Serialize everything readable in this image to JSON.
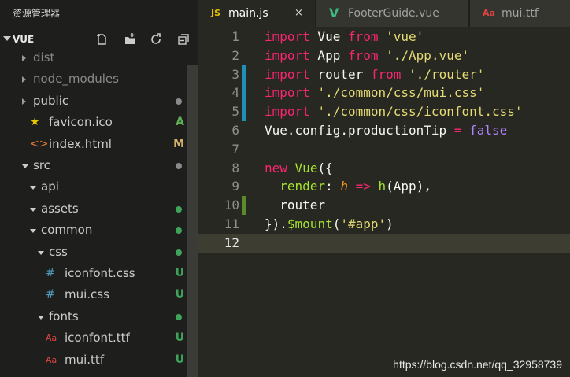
{
  "sidebar": {
    "header_title": "资源管理器",
    "section_title": "VUE",
    "actions": [
      "new-file-icon",
      "new-folder-icon",
      "refresh-icon",
      "collapse-all-icon"
    ],
    "items": [
      {
        "label": "dist",
        "type": "folder",
        "expanded": false,
        "dim": true
      },
      {
        "label": "node_modules",
        "type": "folder",
        "expanded": false,
        "dim": true
      },
      {
        "label": "public",
        "type": "folder",
        "expanded": false,
        "status": "dot",
        "status_color": "#8a8a8a"
      },
      {
        "label": "favicon.ico",
        "type": "file",
        "icon": "star-icon",
        "icon_color": "#e5c400",
        "badge": "A",
        "badge_color": "#5fae55"
      },
      {
        "label": "index.html",
        "type": "file",
        "icon": "html-icon",
        "icon_color": "#e37933",
        "badge": "M",
        "badge_color": "#d4b06a"
      },
      {
        "label": "src",
        "type": "folder",
        "expanded": true,
        "status": "dot",
        "status_color": "#8a8a8a"
      },
      {
        "label": "api",
        "type": "folder",
        "expanded": true
      },
      {
        "label": "assets",
        "type": "folder",
        "expanded": true,
        "status": "dot",
        "status_color": "#3fa35c"
      },
      {
        "label": "common",
        "type": "folder",
        "expanded": true,
        "status": "dot",
        "status_color": "#3fa35c"
      },
      {
        "label": "css",
        "type": "folder",
        "expanded": true,
        "status": "dot",
        "status_color": "#3fa35c"
      },
      {
        "label": "iconfont.css",
        "type": "file",
        "icon": "hash-icon",
        "icon_color": "#519aba",
        "badge": "U",
        "badge_color": "#3fa35c"
      },
      {
        "label": "mui.css",
        "type": "file",
        "icon": "hash-icon",
        "icon_color": "#519aba",
        "badge": "U",
        "badge_color": "#3fa35c"
      },
      {
        "label": "fonts",
        "type": "folder",
        "expanded": true,
        "status": "dot",
        "status_color": "#3fa35c"
      },
      {
        "label": "iconfont.ttf",
        "type": "file",
        "icon": "font-icon",
        "icon_color": "#e04444",
        "badge": "U",
        "badge_color": "#3fa35c"
      },
      {
        "label": "mui.ttf",
        "type": "file",
        "icon": "font-icon",
        "icon_color": "#e04444",
        "badge": "U",
        "badge_color": "#3fa35c"
      }
    ]
  },
  "tabs": [
    {
      "label": "main.js",
      "icon_text": "JS",
      "icon_color": "#e5c400",
      "active": true,
      "close": "×"
    },
    {
      "label": "FooterGuide.vue",
      "icon_text": "V",
      "icon_color": "#41b883",
      "active": false
    },
    {
      "label": "mui.ttf",
      "icon_text": "Aa",
      "icon_color": "#e04444",
      "active": false
    }
  ],
  "editor": {
    "current_line": 12,
    "lines": [
      {
        "n": "1",
        "tokens": [
          [
            "kw",
            "import"
          ],
          [
            "",
            " Vue "
          ],
          [
            "kw",
            "from"
          ],
          [
            "",
            " "
          ],
          [
            "str",
            "'vue'"
          ]
        ]
      },
      {
        "n": "2",
        "tokens": [
          [
            "kw",
            "import"
          ],
          [
            "",
            " App "
          ],
          [
            "kw",
            "from"
          ],
          [
            "",
            " "
          ],
          [
            "str",
            "'./App.vue'"
          ]
        ]
      },
      {
        "n": "3",
        "tokens": [
          [
            "kw",
            "import"
          ],
          [
            "",
            " router "
          ],
          [
            "kw",
            "from"
          ],
          [
            "",
            " "
          ],
          [
            "str",
            "'./router'"
          ]
        ]
      },
      {
        "n": "4",
        "tokens": [
          [
            "kw",
            "import"
          ],
          [
            "",
            " "
          ],
          [
            "str",
            "'./common/css/mui.css'"
          ]
        ]
      },
      {
        "n": "5",
        "tokens": [
          [
            "kw",
            "import"
          ],
          [
            "",
            " "
          ],
          [
            "str",
            "'./common/css/iconfont.css'"
          ]
        ]
      },
      {
        "n": "6",
        "tokens": [
          [
            "",
            "Vue.config.productionTip "
          ],
          [
            "kw",
            "="
          ],
          [
            "",
            " "
          ],
          [
            "bool",
            "false"
          ]
        ]
      },
      {
        "n": "7",
        "tokens": []
      },
      {
        "n": "8",
        "tokens": [
          [
            "kw",
            "new"
          ],
          [
            "",
            " "
          ],
          [
            "fn",
            "Vue"
          ],
          [
            "",
            "({"
          ]
        ]
      },
      {
        "n": "9",
        "tokens": [
          [
            "",
            "  "
          ],
          [
            "fn",
            "render"
          ],
          [
            "",
            ": "
          ],
          [
            "param",
            "h"
          ],
          [
            "",
            " "
          ],
          [
            "kw",
            "=>"
          ],
          [
            "",
            " "
          ],
          [
            "fn",
            "h"
          ],
          [
            "",
            "(App),"
          ]
        ]
      },
      {
        "n": "10",
        "tokens": [
          [
            "",
            "  router"
          ]
        ]
      },
      {
        "n": "11",
        "tokens": [
          [
            "",
            "})."
          ],
          [
            "fn",
            "$mount"
          ],
          [
            "",
            "("
          ],
          [
            "str",
            "'#app'"
          ],
          [
            "",
            ")"
          ]
        ]
      },
      {
        "n": "12",
        "tokens": []
      }
    ],
    "gutter_marks": [
      {
        "from": 3,
        "to": 5,
        "color": "#1f8fb8"
      },
      {
        "from": 10,
        "to": 10,
        "color": "#5a8a2a"
      }
    ]
  },
  "watermark": "https://blog.csdn.net/qq_32958739"
}
